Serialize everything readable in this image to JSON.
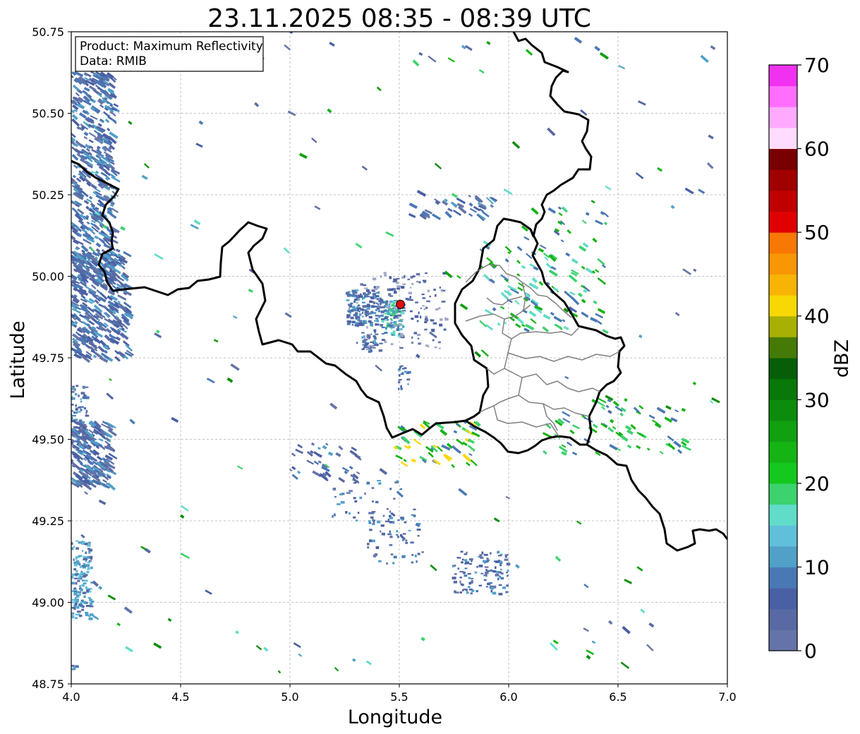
{
  "title": "23.11.2025 08:35 - 08:39 UTC",
  "xlabel": "Longitude",
  "ylabel": "Latitude",
  "xticks": [
    "4.0",
    "4.5",
    "5.0",
    "5.5",
    "6.0",
    "6.5",
    "7.0"
  ],
  "yticks": [
    "50.75",
    "50.50",
    "50.25",
    "50.00",
    "49.75",
    "49.50",
    "49.25",
    "49.00",
    "48.75"
  ],
  "info": {
    "product": "Product: Maximum Reflectivity",
    "data": "Data: RMIB"
  },
  "colorbar": {
    "label": "dBZ",
    "ticks": [
      "0",
      "10",
      "20",
      "30",
      "40",
      "50",
      "60",
      "70"
    ],
    "colors": [
      "#6474a8",
      "#5869a4",
      "#4a60a4",
      "#4a78b4",
      "#50a0c8",
      "#60c0dc",
      "#60dcc8",
      "#3cd26e",
      "#14c81e",
      "#14b414",
      "#10a010",
      "#0c8c0c",
      "#087808",
      "#065e06",
      "#467a06",
      "#a8b004",
      "#f8d804",
      "#f8b404",
      "#f89604",
      "#f87804",
      "#e00000",
      "#c00000",
      "#a00000",
      "#780000",
      "#ffdcff",
      "#ffaaff",
      "#ff6eff",
      "#f032f0"
    ]
  },
  "map": {
    "x_range": [
      4.0,
      7.0
    ],
    "y_range": [
      48.75,
      50.75
    ],
    "grid": true,
    "radar_site": {
      "lon": 5.505,
      "lat": 49.914
    },
    "colors": {
      "border": "#000000",
      "admin": "#808080",
      "radar_marker": "#e01010"
    }
  }
}
